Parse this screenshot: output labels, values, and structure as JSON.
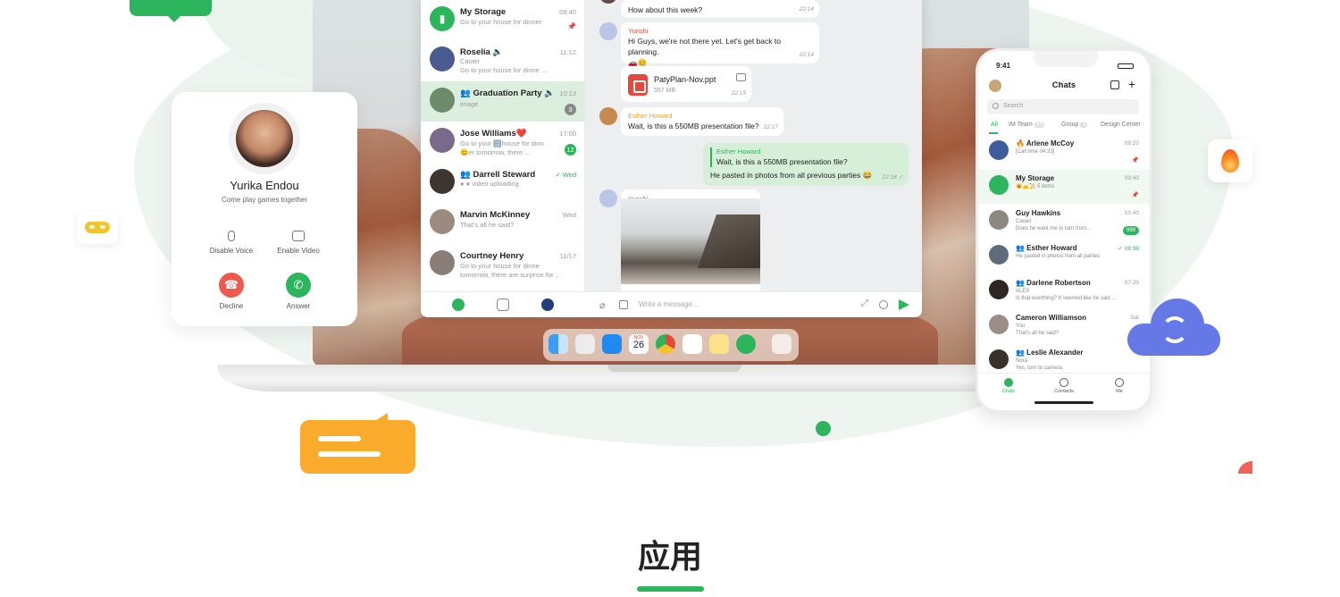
{
  "chat_list": [
    {
      "name": "My Storage",
      "time": "09:40",
      "sub1": "Go to your house for dinner",
      "sub2": "",
      "badge": "",
      "pinned": true,
      "avatar_color": "#2db55d"
    },
    {
      "name": "Roselia 🔈",
      "time": "11:12",
      "sub1": "Caster",
      "sub2": "Go to your house for dinne ...",
      "badge": "",
      "pinned": false,
      "avatar_color": "#4a5b8f"
    },
    {
      "name": "👥 Graduation Party 🔈",
      "time": "10:13",
      "sub1": "image",
      "sub2": "",
      "badge": "3",
      "pinned": false,
      "avatar_color": "#6d8a6a"
    },
    {
      "name": "Jose Williams❤️",
      "time": "17:00",
      "sub1": "Go to your 🔢house for dinn",
      "sub2": "😊er tomorrow, there ...",
      "badge": "12",
      "pinned": false,
      "avatar_color": "#7a6a8a"
    },
    {
      "name": "👥 Darrell Steward",
      "time": "✓ Wed",
      "sub1": "● ● video uploading",
      "sub2": "",
      "badge": "",
      "pinned": false,
      "avatar_color": "#3e3531"
    },
    {
      "name": "Marvin McKinney",
      "time": "Wed",
      "sub1": "That's all he said?",
      "sub2": "",
      "badge": "",
      "pinned": false,
      "avatar_color": "#9b8a7d"
    },
    {
      "name": "Courtney Henry",
      "time": "11/17",
      "sub1": "Go to your house for dinne",
      "sub2": "tomorrow, there are surprise for ...",
      "badge": "",
      "pinned": false,
      "avatar_color": "#8a7d75"
    }
  ],
  "messages": {
    "m1_text": "How about this week?",
    "m1_time": "22:14",
    "m2_sender": "Yurishi",
    "m2_text": "Hi Guys, we're not there yet. Let's get back to planning.",
    "m2_emoji": "🚗😊",
    "m2_time": "22:14",
    "file_name": "PatyPlan-Nov.ppt",
    "file_size": "557 MB",
    "file_time": "22:15",
    "m3_sender": "Esther Howard",
    "m3_text": "Wait, is this a 550MB presentation file?",
    "m3_time": "22:17",
    "reply_name": "Esther Howard",
    "reply_quote": "Wait, is this a 550MB presentation file?",
    "m4_text": "He pasted in photos from all previous parties 😂",
    "m4_time": "22:18 ✓",
    "m5_sender": "Yurishi"
  },
  "input": {
    "placeholder": "Write a message..."
  },
  "call_card": {
    "name": "Yurika Endou",
    "status": "Come play games together",
    "disable_voice": "Disable Voice",
    "enable_video": "Enable Video",
    "decline": "Decline",
    "answer": "Answer"
  },
  "phone": {
    "time": "9:41",
    "title": "Chats",
    "search_placeholder": "Search",
    "tabs": [
      "All",
      "IM Team",
      "Group",
      "Design Center"
    ],
    "tab_counts": [
      "",
      "99",
      "3",
      ""
    ],
    "items": [
      {
        "name": "🔥 Arlene McCoy",
        "time": "09:20",
        "sub1": "[Call time 04:33]",
        "sub2": "",
        "badge": ""
      },
      {
        "name": "My Storage",
        "time": "09:40",
        "sub1": "😺👝📜 5 items",
        "sub2": "",
        "badge": ""
      },
      {
        "name": "Guy Hawkins",
        "time": "10:40",
        "sub1": "Caster",
        "sub2": "Does he want me to turn from...",
        "badge": "999"
      },
      {
        "name": "👥 Esther Howard",
        "time": "✓ 08:38",
        "sub1": "He pasted in photos from all parties",
        "sub2": "",
        "badge": ""
      },
      {
        "name": "👥 Darlene Robertson",
        "time": "07:20",
        "sub1": "ALEX",
        "sub2": "Is that everthing? It seemed like he said ...",
        "badge": ""
      },
      {
        "name": "Cameron Williamson",
        "time": "Sat",
        "sub1": "You",
        "sub2": "That's all he said?",
        "badge": ""
      },
      {
        "name": "👥 Leslie Alexander",
        "time": "",
        "sub1": "Nora",
        "sub2": "Yes, turn to camera",
        "badge": ""
      }
    ],
    "nav": [
      "Chats",
      "Contacts",
      "Me"
    ]
  },
  "dock": {
    "calendar_month": "NOV",
    "calendar_day": "26"
  },
  "section": {
    "title": "应用"
  }
}
